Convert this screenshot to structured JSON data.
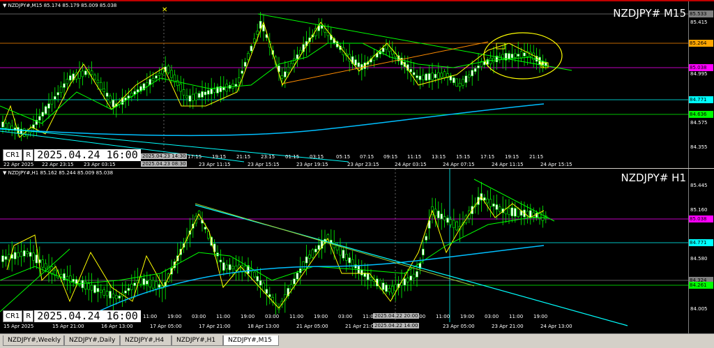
{
  "top": {
    "header": "NZDJPY#,M15  85.174 85.179 85.009 85.038",
    "symbol": "NZDJPY# M15",
    "price_tags": [
      {
        "value": "85.533",
        "bg": "#808080"
      },
      {
        "value": "85.264",
        "bg": "#ffa500"
      },
      {
        "value": "85.038",
        "bg": "#ff00ff"
      },
      {
        "value": "84.771",
        "bg": "#00ffff"
      },
      {
        "value": "84.636",
        "bg": "#00ff00"
      }
    ],
    "y_labels": [
      "85.415",
      "84.995",
      "84.575",
      "84.355"
    ],
    "x_labels": [
      "22 Apr 2025",
      "22 Apr 23:15",
      "23 Apr 03:15",
      "17:15",
      "19:15",
      "21:15",
      "23:15",
      "01:15",
      "03:15",
      "05:15",
      "07:15",
      "09:15",
      "11:15",
      "13:15",
      "15:15",
      "17:15",
      "19:15",
      "21:15",
      "23 Apr 11:15",
      "23 Apr 15:15",
      "23 Apr 19:15",
      "23 Apr 23:15",
      "24 Apr 03:15",
      "24 Apr 07:15",
      "24 Apr 11:15",
      "24 Apr 15:15"
    ],
    "x_box_labels": [
      "2025.04.23 14:30",
      "2025.04.23 08:30"
    ],
    "cr_button": "CR1",
    "r_button": "R",
    "datetime": "2025.04.24 16:00"
  },
  "bottom": {
    "header": "NZDJPY#,H1  85.162 85.244 85.009 85.038",
    "symbol": "NZDJPY# H1",
    "price_tags": [
      {
        "value": "85.038",
        "bg": "#ff00ff"
      },
      {
        "value": "84.771",
        "bg": "#00ffff"
      },
      {
        "value": "84.324",
        "bg": "#808080"
      },
      {
        "value": "84.261",
        "bg": "#00ff00"
      }
    ],
    "y_labels": [
      "85.445",
      "85.160",
      "84.580",
      "84.005"
    ],
    "x_labels": [
      "15 Apr 2025",
      "15 Apr 21:00",
      "16 Apr 13:00",
      "17 Apr 05:00",
      "17 Apr 21:00",
      "18 Apr 13:00",
      "21 Apr 05:00",
      "21 Apr 21:00",
      "23 Apr 05:00",
      "23 Apr 21:00",
      "24 Apr 13:00",
      "11:00",
      "19:00",
      "03:00",
      "11:00",
      "19:00",
      "03:00",
      "11:00",
      "19:00",
      "03:00",
      "11:00",
      "19:00",
      "03:00",
      "11:00",
      "19:00",
      "03:00",
      "11:00",
      "19:00"
    ],
    "x_box_labels": [
      "2025.04.22 20:00",
      "2025.04.22 14:00"
    ],
    "cr_button": "CR1",
    "r_button": "R",
    "datetime": "2025.04.24 16:00"
  },
  "tabs": [
    {
      "label": "NZDJPY#,Weekly",
      "active": false
    },
    {
      "label": "NZDJPY#,Daily",
      "active": false
    },
    {
      "label": "NZDJPY#,H4",
      "active": false
    },
    {
      "label": "NZDJPY#,H1",
      "active": false
    },
    {
      "label": "NZDJPY#,M15",
      "active": true
    }
  ],
  "colors": {
    "background": "#000000",
    "candles": "#00ff00",
    "ma_yellow": "#ffff00",
    "trend_green": "#00ff00",
    "trend_cyan": "#00ffff",
    "ma_cyan": "#00bfff",
    "line_orange": "#ff8c00",
    "line_magenta": "#ff00ff"
  }
}
